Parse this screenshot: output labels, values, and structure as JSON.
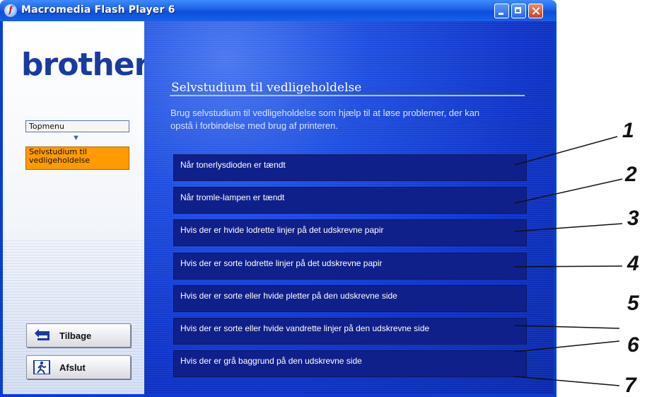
{
  "window": {
    "title": "Macromedia Flash Player 6"
  },
  "sidebar": {
    "logo": "brother",
    "nav": {
      "topmenu": "Topmenu",
      "current": "Selvstudium til vedligeholdelse"
    },
    "buttons": {
      "back": "Tilbage",
      "exit": "Afslut"
    }
  },
  "main": {
    "heading": "Selvstudium til vedligeholdelse",
    "intro": "Brug selvstudium til vedligeholdelse som hjælp til at løse problemer, der kan opstå i forbindelse med brug af printeren.",
    "items": [
      "Når tonerlysdioden er tændt",
      "Når tromle-lampen er tændt",
      "Hvis der er hvide lodrette linjer på det udskrevne papir",
      "Hvis der er sorte lodrette linjer på det udskrevne papir",
      "Hvis der er sorte eller hvide pletter på den udskrevne side",
      "Hvis der er sorte eller hvide vandrette linjer på den udskrevne side",
      "Hvis der er grå baggrund på den udskrevne side"
    ]
  },
  "callouts": [
    "1",
    "2",
    "3",
    "4",
    "5",
    "6",
    "7"
  ],
  "icons": {
    "title": "flash-player-icon",
    "back": "back-arrow-icon",
    "exit": "exit-door-icon"
  }
}
